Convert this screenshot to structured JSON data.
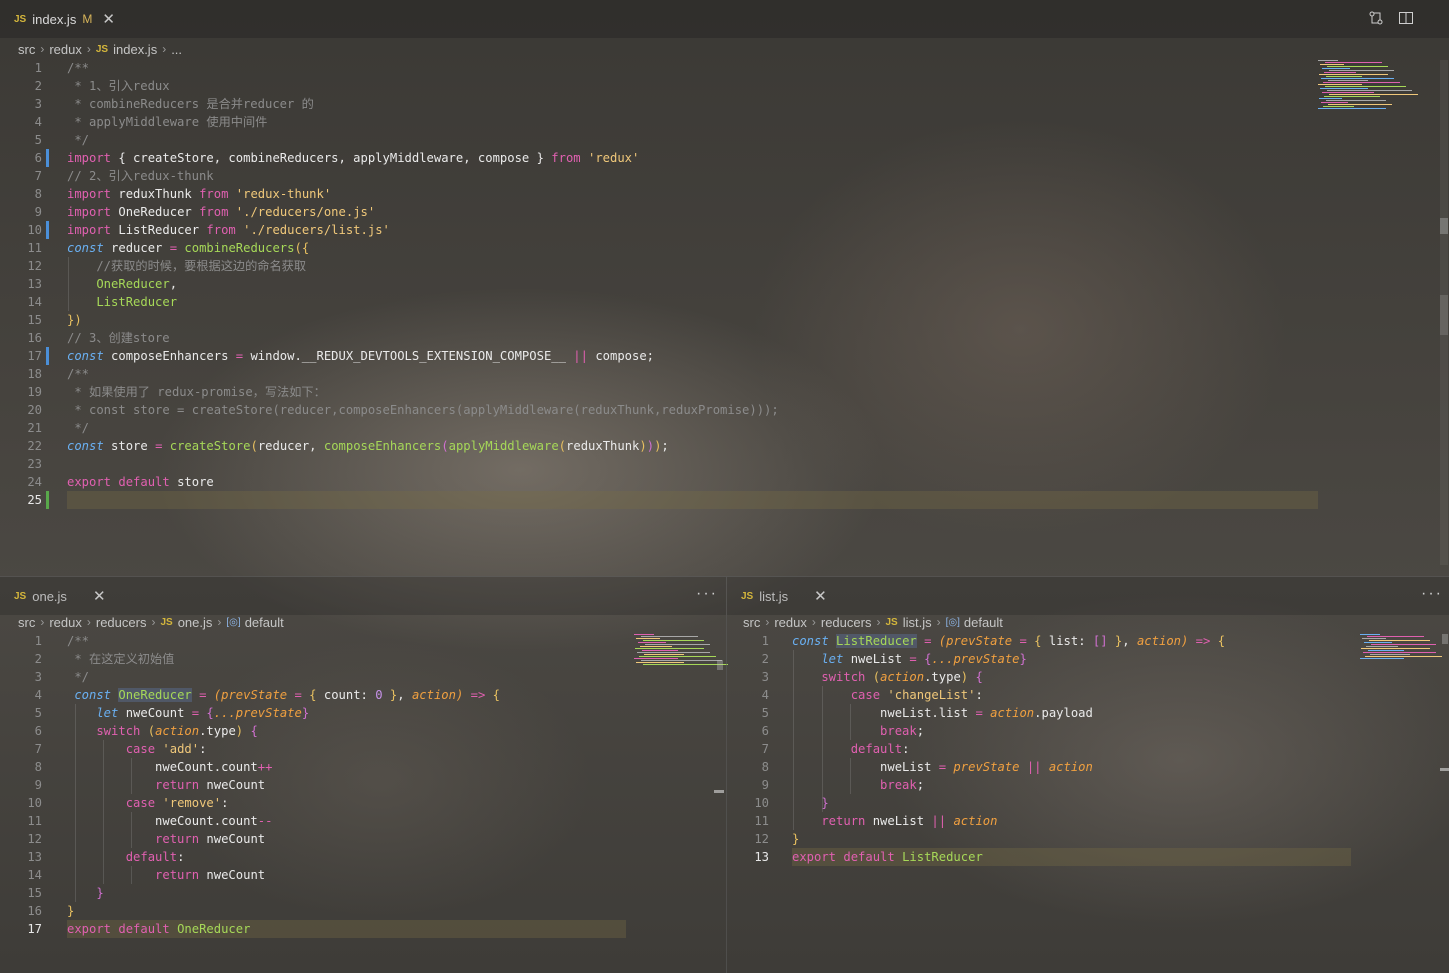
{
  "top": {
    "tab": {
      "label": "index.js",
      "modified": "M",
      "close": "✕"
    },
    "breadcrumb": [
      "src",
      "redux",
      "index.js",
      "..."
    ],
    "icons": [
      "compare-changes-icon",
      "split-editor-icon"
    ]
  },
  "left": {
    "tab": {
      "label": "one.js",
      "close": "✕"
    },
    "breadcrumb": [
      "src",
      "redux",
      "reducers",
      "one.js",
      "default"
    ],
    "more": "···"
  },
  "right": {
    "tab": {
      "label": "list.js",
      "close": "✕"
    },
    "breadcrumb": [
      "src",
      "redux",
      "reducers",
      "list.js",
      "default"
    ],
    "more": "···"
  },
  "code_top": [
    [
      [
        "cm",
        "/**"
      ]
    ],
    [
      [
        "cm",
        " * 1、引入redux"
      ]
    ],
    [
      [
        "cm",
        " * combineReducers 是合并reducer 的"
      ]
    ],
    [
      [
        "cm",
        " * applyMiddleware 使用中间件"
      ]
    ],
    [
      [
        "cm",
        " */"
      ]
    ],
    [
      [
        "kw",
        "import"
      ],
      [
        "var",
        " { createStore, combineReducers, applyMiddleware, compose "
      ],
      [
        "var",
        "} "
      ],
      [
        "kw",
        "from"
      ],
      [
        "str",
        " 'redux'"
      ]
    ],
    [
      [
        "cm",
        "// 2、引入redux-thunk"
      ]
    ],
    [
      [
        "kw",
        "import"
      ],
      [
        "var",
        " reduxThunk "
      ],
      [
        "kw",
        "from"
      ],
      [
        "str",
        " 'redux-thunk'"
      ]
    ],
    [
      [
        "kw",
        "import"
      ],
      [
        "var",
        " OneReducer "
      ],
      [
        "kw",
        "from"
      ],
      [
        "str",
        " './reducers/one.js'"
      ]
    ],
    [
      [
        "kw",
        "import"
      ],
      [
        "var",
        " ListReducer "
      ],
      [
        "kw",
        "from"
      ],
      [
        "str",
        " './reducers/list.js'"
      ]
    ],
    [
      [
        "k2",
        "const"
      ],
      [
        "var",
        " reducer "
      ],
      [
        "op",
        "="
      ],
      [
        "fn",
        " combineReducers"
      ],
      [
        "brk",
        "({"
      ]
    ],
    [
      [
        "cm",
        "    //获取的时候，要根据这边的命名获取"
      ]
    ],
    [
      [
        "grn",
        "    OneReducer"
      ],
      [
        "var",
        ","
      ]
    ],
    [
      [
        "grn",
        "    ListReducer"
      ]
    ],
    [
      [
        "brk",
        "})"
      ]
    ],
    [
      [
        "cm",
        "// 3、创建store"
      ]
    ],
    [
      [
        "k2",
        "const"
      ],
      [
        "var",
        " composeEnhancers "
      ],
      [
        "op",
        "="
      ],
      [
        "var",
        " window.__REDUX_DEVTOOLS_EXTENSION_COMPOSE__ "
      ],
      [
        "op",
        "||"
      ],
      [
        "var",
        " compose;"
      ]
    ],
    [
      [
        "cm",
        "/**"
      ]
    ],
    [
      [
        "cm",
        " * 如果使用了 redux-promise，写法如下："
      ]
    ],
    [
      [
        "cm",
        " * const store = createStore(reducer,composeEnhancers(applyMiddleware(reduxThunk,reduxPromise)));"
      ]
    ],
    [
      [
        "cm",
        " */"
      ]
    ],
    [
      [
        "k2",
        "const"
      ],
      [
        "var",
        " store "
      ],
      [
        "op",
        "="
      ],
      [
        "fn",
        " createStore"
      ],
      [
        "brk",
        "("
      ],
      [
        "var",
        "reducer, "
      ],
      [
        "fn",
        "composeEnhancers"
      ],
      [
        "brk2",
        "("
      ],
      [
        "fn",
        "applyMiddleware"
      ],
      [
        "brk",
        "("
      ],
      [
        "var",
        "reduxThunk"
      ],
      [
        "brk",
        ")"
      ],
      [
        "brk2",
        ")"
      ],
      [
        "brk",
        ")"
      ],
      [
        "var",
        ";"
      ]
    ],
    [
      [
        "var",
        ""
      ]
    ],
    [
      [
        "kw",
        "export"
      ],
      [
        "kw",
        " default"
      ],
      [
        "var",
        " store"
      ]
    ],
    [
      [
        "var",
        ""
      ]
    ]
  ],
  "code_left": [
    [
      [
        "cm",
        "/**"
      ]
    ],
    [
      [
        "cm",
        " * 在这定义初始值"
      ]
    ],
    [
      [
        "cm",
        " */"
      ]
    ],
    [
      [
        "k2",
        " const"
      ],
      [
        "var",
        " "
      ],
      [
        "fn",
        "OneReducer"
      ],
      [
        "var",
        " "
      ],
      [
        "op",
        "="
      ],
      [
        "it",
        " (prevState"
      ],
      [
        "op",
        " ="
      ],
      [
        "brk",
        " {"
      ],
      [
        "var",
        " count: "
      ],
      [
        "num",
        "0"
      ],
      [
        "brk",
        " }"
      ],
      [
        "var",
        ", "
      ],
      [
        "it",
        "action"
      ],
      [
        "it",
        ")"
      ],
      [
        "op",
        " =>"
      ],
      [
        "brk",
        " {"
      ]
    ],
    [
      [
        "k2",
        "    let"
      ],
      [
        "var",
        " nweCount "
      ],
      [
        "op",
        "="
      ],
      [
        "brk2",
        " {"
      ],
      [
        "it",
        "...prevState"
      ],
      [
        "brk2",
        "}"
      ]
    ],
    [
      [
        "kw",
        "    switch"
      ],
      [
        "brk",
        " ("
      ],
      [
        "it",
        "action"
      ],
      [
        "var",
        ".type"
      ],
      [
        "brk",
        ")"
      ],
      [
        "brk2",
        " {"
      ]
    ],
    [
      [
        "kw",
        "        case"
      ],
      [
        "str",
        " 'add'"
      ],
      [
        "var",
        ":"
      ]
    ],
    [
      [
        "var",
        "            nweCount.count"
      ],
      [
        "op",
        "++"
      ]
    ],
    [
      [
        "kw",
        "            return"
      ],
      [
        "var",
        " nweCount"
      ]
    ],
    [
      [
        "kw",
        "        case"
      ],
      [
        "str",
        " 'remove'"
      ],
      [
        "var",
        ":"
      ]
    ],
    [
      [
        "var",
        "            nweCount.count"
      ],
      [
        "op",
        "--"
      ]
    ],
    [
      [
        "kw",
        "            return"
      ],
      [
        "var",
        " nweCount"
      ]
    ],
    [
      [
        "kw",
        "        default"
      ],
      [
        "var",
        ":"
      ]
    ],
    [
      [
        "kw",
        "            return"
      ],
      [
        "var",
        " nweCount"
      ]
    ],
    [
      [
        "brk2",
        "    }"
      ]
    ],
    [
      [
        "brk",
        "}"
      ]
    ],
    [
      [
        "kw",
        "export"
      ],
      [
        "kw",
        " default"
      ],
      [
        "fn",
        " OneReducer"
      ]
    ]
  ],
  "code_right": [
    [
      [
        "k2",
        "const"
      ],
      [
        "var",
        " "
      ],
      [
        "fn",
        "ListReducer"
      ],
      [
        "var",
        " "
      ],
      [
        "op",
        "="
      ],
      [
        "it",
        " (prevState"
      ],
      [
        "op",
        " ="
      ],
      [
        "brk",
        " {"
      ],
      [
        "var",
        " list: "
      ],
      [
        "brk2",
        "[]"
      ],
      [
        "brk",
        " }"
      ],
      [
        "var",
        ", "
      ],
      [
        "it",
        "action"
      ],
      [
        "it",
        ")"
      ],
      [
        "op",
        " =>"
      ],
      [
        "brk",
        " {"
      ]
    ],
    [
      [
        "k2",
        "    let"
      ],
      [
        "var",
        " nweList "
      ],
      [
        "op",
        "="
      ],
      [
        "brk2",
        " {"
      ],
      [
        "it",
        "...prevState"
      ],
      [
        "brk2",
        "}"
      ]
    ],
    [
      [
        "kw",
        "    switch"
      ],
      [
        "brk",
        " ("
      ],
      [
        "it",
        "action"
      ],
      [
        "var",
        ".type"
      ],
      [
        "brk",
        ")"
      ],
      [
        "brk2",
        " {"
      ]
    ],
    [
      [
        "kw",
        "        case"
      ],
      [
        "str",
        " 'changeList'"
      ],
      [
        "var",
        ":"
      ]
    ],
    [
      [
        "var",
        "            nweList.list "
      ],
      [
        "op",
        "="
      ],
      [
        "it",
        " action"
      ],
      [
        "var",
        ".payload"
      ]
    ],
    [
      [
        "kw",
        "            break"
      ],
      [
        "var",
        ";"
      ]
    ],
    [
      [
        "kw",
        "        default"
      ],
      [
        "var",
        ":"
      ]
    ],
    [
      [
        "var",
        "            nweList "
      ],
      [
        "op",
        "="
      ],
      [
        "it",
        " prevState "
      ],
      [
        "op",
        "||"
      ],
      [
        "it",
        " action"
      ]
    ],
    [
      [
        "kw",
        "            break"
      ],
      [
        "var",
        ";"
      ]
    ],
    [
      [
        "brk2",
        "    }"
      ]
    ],
    [
      [
        "kw",
        "    return"
      ],
      [
        "var",
        " nweList "
      ],
      [
        "op",
        "||"
      ],
      [
        "it",
        " action"
      ]
    ],
    [
      [
        "brk",
        "}"
      ]
    ],
    [
      [
        "kw",
        "export"
      ],
      [
        "kw",
        " default"
      ],
      [
        "fn",
        " ListReducer"
      ]
    ]
  ]
}
